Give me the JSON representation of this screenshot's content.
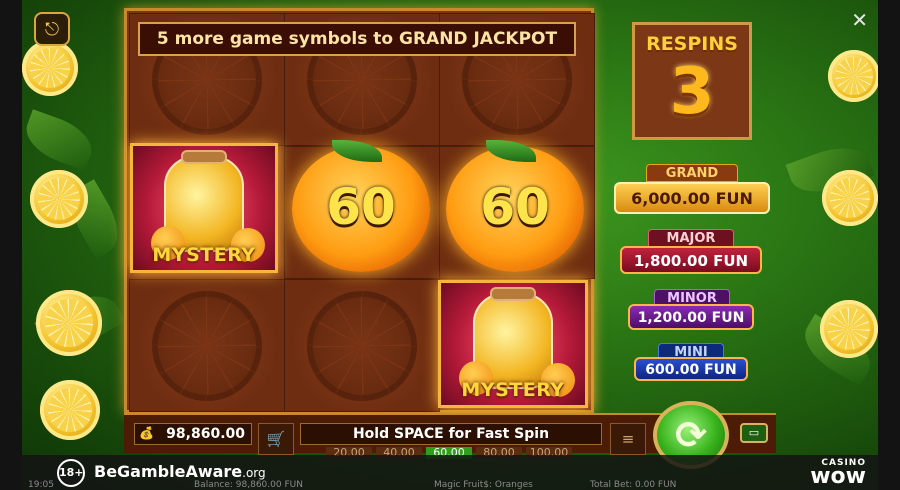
{
  "banner": {
    "text": "5 more game symbols to GRAND JACKPOT"
  },
  "respins": {
    "title": "RESPINS",
    "count": "3"
  },
  "jackpots": [
    {
      "label": "GRAND",
      "value": "6,000.00 FUN",
      "color": "#e8a51c"
    },
    {
      "label": "MAJOR",
      "value": "1,800.00 FUN",
      "color": "#b5172f"
    },
    {
      "label": "MINOR",
      "value": "1,200.00 FUN",
      "color": "#7a1e9a"
    },
    {
      "label": "MINI",
      "value": "600.00 FUN",
      "color": "#1537a8"
    }
  ],
  "reel_symbols": {
    "mystery_label": "MYSTERY",
    "orange_values": [
      "60",
      "60"
    ]
  },
  "bottom": {
    "balance_icon": "money-bag-icon",
    "balance": "98,860.00",
    "hold_text": "Hold SPACE for Fast Spin",
    "bets": [
      "20.00",
      "40.00",
      "60.00",
      "80.00",
      "100.00"
    ],
    "selected_bet": "60.00"
  },
  "footer": {
    "age": "18+",
    "gamble_aware": "BeGambleAware",
    "gamble_aware_tld": ".org",
    "casino_small": "CASINO",
    "casino_big": "wow",
    "time": "19:05",
    "balance_line": "Balance: 98,860.00 FUN",
    "game_line": "Magic Fruit$: Oranges",
    "total_bet": "Total Bet: 0.00 FUN"
  },
  "colors": {
    "accent_gold": "#d09a45",
    "spin_green": "#38b31c"
  }
}
